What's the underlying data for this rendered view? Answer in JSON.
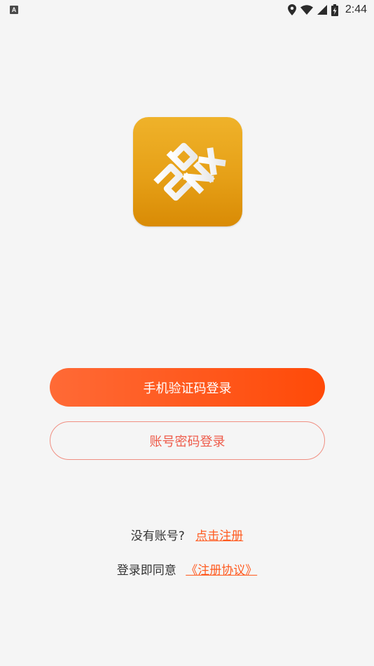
{
  "status_bar": {
    "notification_letter": "A",
    "time": "2:44",
    "icons": [
      "location-icon",
      "wifi-icon",
      "signal-icon",
      "battery-charging-icon"
    ]
  },
  "logo": {
    "icon": "app-logo",
    "colors": {
      "top": "#efb22a",
      "bottom": "#d98b05"
    }
  },
  "buttons": {
    "sms_login": "手机验证码登录",
    "password_login": "账号密码登录"
  },
  "register": {
    "prompt": "没有账号?",
    "link": "点击注册"
  },
  "agreement": {
    "prompt": "登录即同意",
    "link": "《注册协议》"
  },
  "colors": {
    "accent": "#ff5a1f",
    "secondary_text": "#ee5b4a",
    "background": "#f5f5f5"
  }
}
